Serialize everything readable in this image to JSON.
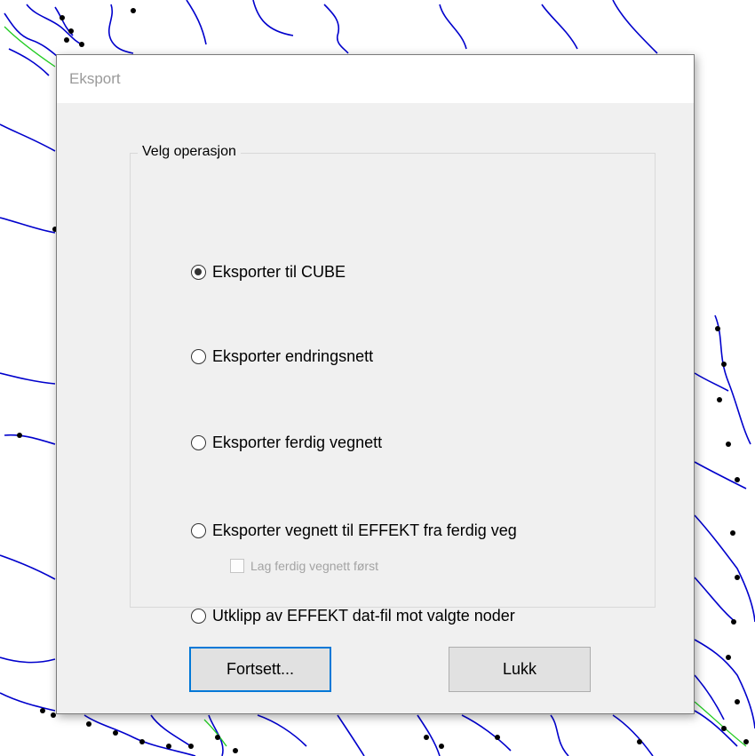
{
  "dialog": {
    "title": "Eksport",
    "group_label": "Velg operasjon",
    "options": [
      {
        "label": "Eksporter til CUBE",
        "selected": true
      },
      {
        "label": "Eksporter endringsnett",
        "selected": false
      },
      {
        "label": "Eksporter ferdig vegnett",
        "selected": false
      },
      {
        "label": "Eksporter vegnett til EFFEKT fra ferdig veg",
        "selected": false
      },
      {
        "label": "Utklipp av EFFEKT dat-fil mot valgte noder",
        "selected": false
      }
    ],
    "checkbox": {
      "label": "Lag ferdig vegnett først",
      "checked": false,
      "enabled": false
    },
    "buttons": {
      "continue": "Fortsett...",
      "close": "Lukk"
    }
  },
  "colors": {
    "map_lines": "#0000cc",
    "map_nodes": "#000000",
    "map_green_lines": "#22cc22",
    "accent": "#0078d7"
  }
}
